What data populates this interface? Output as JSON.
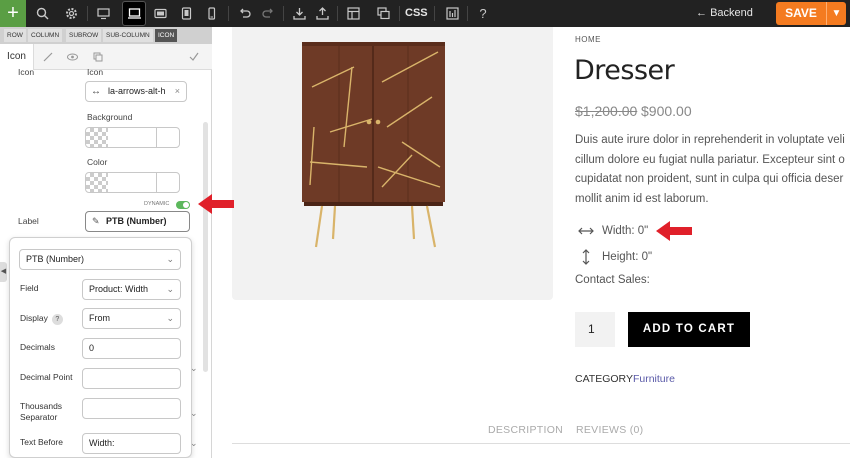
{
  "toolbar": {
    "add": "+",
    "css_label": "CSS",
    "backend_label": "Backend",
    "save_label": "SAVE",
    "help": "?"
  },
  "panel": {
    "breadcrumb": [
      "ROW",
      "COLUMN",
      "SUBROW",
      "SUB-COLUMN",
      "ICON"
    ],
    "tab_icon": "Icon",
    "partial_label": "Icon",
    "partial_label_2": "Icon",
    "icon_value": "la-arrows-alt-h",
    "icon_clear": "×",
    "background_label": "Background",
    "color_label": "Color",
    "dynamic_label": "DYNAMIC",
    "label_label": "Label",
    "label_value": "PTB (Number)"
  },
  "popover": {
    "source_value": "PTB (Number)",
    "field_label": "Field",
    "field_value": "Product: Width",
    "display_label": "Display",
    "display_help": "?",
    "display_value": "From",
    "decimals_label": "Decimals",
    "decimals_value": "0",
    "decimal_point_label": "Decimal Point",
    "decimal_point_value": "",
    "thousands_label_1": "Thousands",
    "thousands_label_2": "Separator",
    "thousands_value": "",
    "text_before_label": "Text Before",
    "text_before_value": "Width:"
  },
  "product": {
    "breadcrumb": "HOME",
    "title": "Dresser",
    "price_old": "$1,200.00",
    "price_new": "$900.00",
    "description": [
      "Duis aute irure dolor in reprehenderit in voluptate veli",
      "cillum dolore eu fugiat nulla pariatur. Excepteur sint o",
      "cupidatat non proident, sunt in culpa qui officia deser",
      "mollit anim id est laborum."
    ],
    "width_text": "Width: 0\"",
    "height_text": "Height: 0\"",
    "contact": "Contact Sales:",
    "quantity": "1",
    "add_to_cart": "ADD TO CART",
    "category_label": "CATEGORY",
    "category_link": "Furniture",
    "tab_description": "DESCRIPTION",
    "tab_reviews": "REVIEWS (0)"
  },
  "colors": {
    "accent": "#f47b20",
    "toggle": "#5cb85c",
    "arrow": "#e0202a",
    "wood": "#6e3a26"
  }
}
